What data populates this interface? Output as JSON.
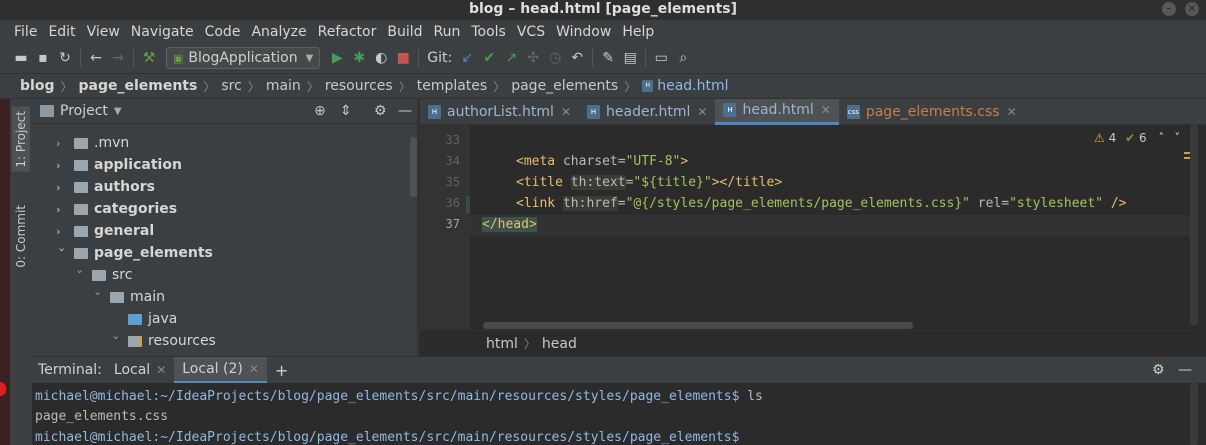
{
  "window": {
    "title": "blog – head.html [page_elements]"
  },
  "menu": [
    "File",
    "Edit",
    "View",
    "Navigate",
    "Code",
    "Analyze",
    "Refactor",
    "Build",
    "Run",
    "Tools",
    "VCS",
    "Window",
    "Help"
  ],
  "toolbar": {
    "run_config": "BlogApplication",
    "git_label": "Git:"
  },
  "breadcrumb": [
    "blog",
    "page_elements",
    "src",
    "main",
    "resources",
    "templates",
    "page_elements",
    "head.html"
  ],
  "left_strip": {
    "project_tab": "1: Project",
    "commit_tab": "0: Commit"
  },
  "project": {
    "header": "Project",
    "tree": [
      {
        "label": ".mvn",
        "bold": false
      },
      {
        "label": "application",
        "bold": true
      },
      {
        "label": "authors",
        "bold": true
      },
      {
        "label": "categories",
        "bold": true
      },
      {
        "label": "general",
        "bold": true
      },
      {
        "label": "page_elements",
        "bold": true
      },
      {
        "label": "src",
        "bold": false
      },
      {
        "label": "main",
        "bold": false
      },
      {
        "label": "java",
        "bold": false
      },
      {
        "label": "resources",
        "bold": false
      }
    ]
  },
  "editor": {
    "tabs": [
      {
        "label": "authorList.html",
        "active": false
      },
      {
        "label": "header.html",
        "active": false
      },
      {
        "label": "head.html",
        "active": true
      },
      {
        "label": "page_elements.css",
        "active": false
      }
    ],
    "line_numbers": [
      "33",
      "34",
      "35",
      "36",
      "37"
    ],
    "code": {
      "l34_tag_open": "<meta ",
      "l34_attr": "charset=",
      "l34_str": "\"UTF-8\"",
      "l34_close": ">",
      "l35_tag_open": "<title ",
      "l35_ns": "th:text",
      "l35_eq": "=",
      "l35_str": "\"${title}\"",
      "l35_close": "></title>",
      "l36_tag_open": "<link ",
      "l36_ns": "th:href",
      "l36_eq": "=",
      "l36_str": "\"@{/styles/page_elements/page_elements.css}\"",
      "l36_attr2": " rel=",
      "l36_str2": "\"stylesheet\"",
      "l36_close": " />",
      "l37": "</head>"
    },
    "inspections": {
      "warnings": "4",
      "checks": "6"
    },
    "crumbs": [
      "html",
      "head"
    ]
  },
  "terminal": {
    "label": "Terminal:",
    "tabs": [
      {
        "label": "Local",
        "active": false
      },
      {
        "label": "Local (2)",
        "active": true
      }
    ],
    "lines": {
      "p1_prompt": "michael@michael:~/IdeaProjects/blog/page_elements/src/main/resources/styles/page_elements$",
      "p1_cmd": " ls",
      "out1": "page_elements.css",
      "p2_prompt": "michael@michael:~/IdeaProjects/blog/page_elements/src/main/resources/styles/page_elements$"
    }
  },
  "colors": {
    "accent": "#4a88c7",
    "tag": "#e8bf6a",
    "string": "#a5c25c",
    "background": "#2b2b2b",
    "panel": "#3c3f41"
  }
}
